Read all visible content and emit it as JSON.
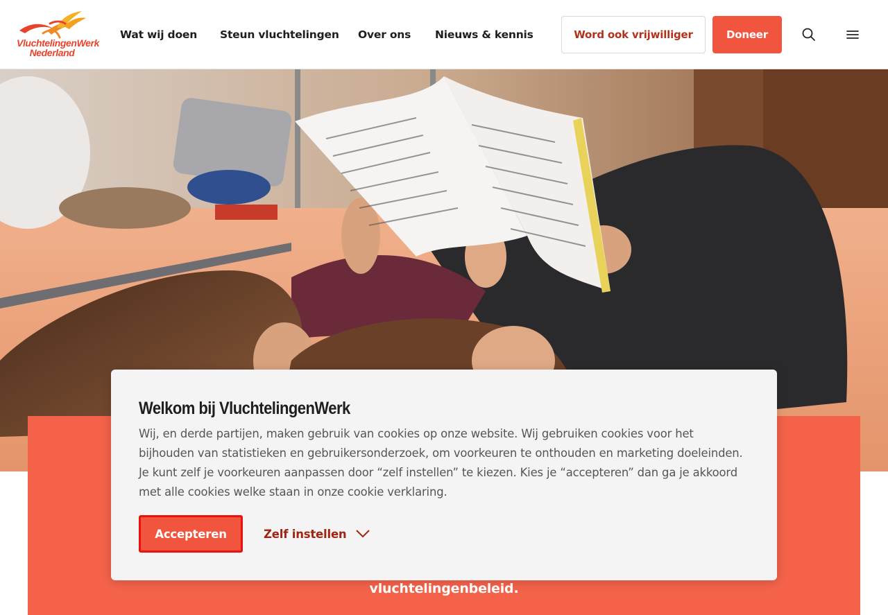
{
  "logo": {
    "line1": "VluchtelingenWerk",
    "line2": "Nederland"
  },
  "nav": {
    "items": [
      {
        "label": "Wat wij doen"
      },
      {
        "label": "Steun vluchtelingen"
      },
      {
        "label": "Over ons"
      },
      {
        "label": "Nieuws & kennis"
      }
    ],
    "volunteer_label": "Word ook vrijwilliger",
    "donate_label": "Doneer",
    "search_icon": "search-icon",
    "menu_icon": "hamburger-menu-icon"
  },
  "hero": {
    "image": "children-reading-book-on-bed-photo"
  },
  "orange_card": {
    "text_fragment": "vluchtelingenbeleid."
  },
  "cookie": {
    "title": "Welkom bij VluchtelingenWerk",
    "body": "Wij, en derde partijen, maken gebruik van cookies op onze website. Wij gebruiken cookies voor het bijhouden van statistieken en gebruikersonderzoek, om voorkeuren te onthouden en marketing doeleinden. Je kunt zelf je voorkeuren aanpassen door “zelf instellen” te kiezen. Kies je “accepteren” dan ga je akkoord met alle cookies welke staan in onze cookie verklaring.",
    "accept_label": "Accepteren",
    "settings_label": "Zelf instellen"
  },
  "colors": {
    "brand": "#f1553d",
    "brand_dark": "#b2321c",
    "card": "#f4624a",
    "dialog_bg": "#f4f4f4"
  }
}
